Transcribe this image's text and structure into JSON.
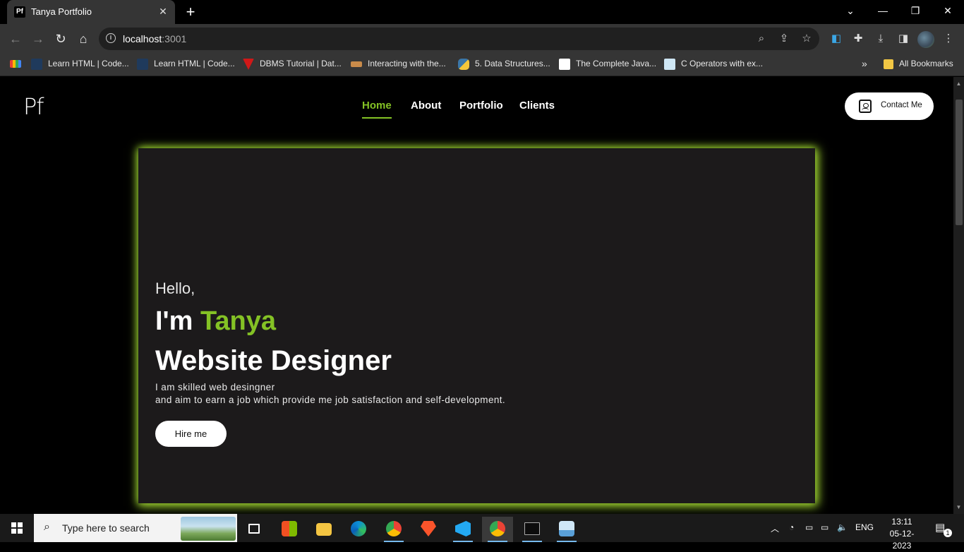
{
  "browser": {
    "tab_title": "Tanya Portfolio",
    "tab_favicon": "Pf",
    "new_tab": "+",
    "url_host": "localhost",
    "url_port": ":3001",
    "bookmarks": [
      {
        "label": "Learn HTML | Code...",
        "icon": "codecademy-icon"
      },
      {
        "label": "Learn HTML | Code...",
        "icon": "codecademy-icon"
      },
      {
        "label": "DBMS Tutorial | Dat...",
        "icon": "javatpoint-icon"
      },
      {
        "label": "Interacting with the...",
        "icon": "page-icon"
      },
      {
        "label": "5. Data Structures...",
        "icon": "python-icon"
      },
      {
        "label": "The Complete Java...",
        "icon": "blank-page-icon"
      },
      {
        "label": "C Operators with ex...",
        "icon": "programiz-icon"
      }
    ],
    "all_bookmarks": "All Bookmarks",
    "overflow": "»"
  },
  "site": {
    "logo": "Pf",
    "nav": [
      "Home",
      "About",
      "Portfolio",
      "Clients"
    ],
    "contact_label": "Contact Me",
    "hero": {
      "hello": "Hello,",
      "iam_prefix": "I'm ",
      "name": "Tanya",
      "role": "Website Designer",
      "desc_line1": "I am skilled web desingner",
      "desc_line2": "and aim to earn a job which provide me job satisfaction and self-development.",
      "cta": "Hire me"
    },
    "colors": {
      "accent": "#84c225",
      "hero_bg": "#1c1a1b",
      "page_bg": "#000000"
    }
  },
  "taskbar": {
    "search_placeholder": "Type here to search",
    "lang": "ENG",
    "time": "13:11",
    "date": "05-12-2023",
    "notification_count": "1"
  }
}
